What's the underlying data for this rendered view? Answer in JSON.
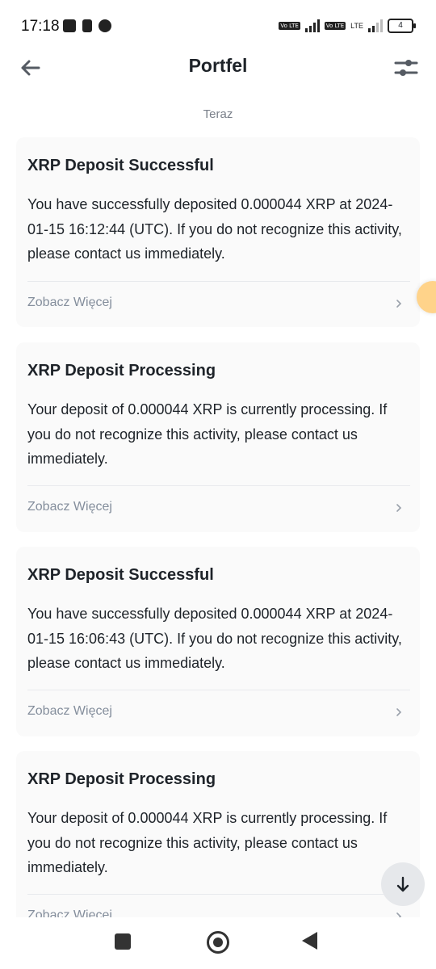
{
  "status_bar": {
    "time": "17:18",
    "volte1": "Vo LTE",
    "volte2": "Vo LTE",
    "lte": "LTE",
    "battery": "4"
  },
  "header": {
    "title": "Portfel",
    "back_icon": "arrow-left-icon",
    "filter_icon": "sliders-icon"
  },
  "time_label": "Teraz",
  "cards": [
    {
      "title": "XRP Deposit Successful",
      "body": "You have successfully deposited 0.000044 XRP at 2024-01-15 16:12:44 (UTC). If you do not recognize this activity, please contact us immediately.",
      "more": "Zobacz Więcej"
    },
    {
      "title": "XRP Deposit Processing",
      "body": "Your deposit of 0.000044 XRP is currently processing. If you do not recognize this activity, please contact us immediately.",
      "more": "Zobacz Więcej"
    },
    {
      "title": "XRP Deposit Successful",
      "body": "You have successfully deposited 0.000044 XRP at 2024-01-15 16:06:43 (UTC). If you do not recognize this activity, please contact us immediately.",
      "more": "Zobacz Więcej"
    },
    {
      "title": "XRP Deposit Processing",
      "body": "Your deposit of 0.000044 XRP is currently processing. If you do not recognize this activity, please contact us immediately.",
      "more": "Zobacz Więcej"
    }
  ],
  "colors": {
    "background": "#ffffff",
    "card": "#fafafa",
    "text": "#1e2329",
    "muted": "#848e9c",
    "accent_fab": "#ffd38a"
  }
}
